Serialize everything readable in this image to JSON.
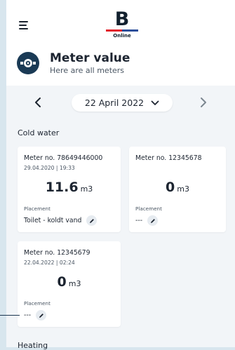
{
  "header": {
    "logo_letter": "B",
    "logo_sub": "Online",
    "title": "Meter value",
    "subtitle": "Here are all meters"
  },
  "date_nav": {
    "date": "22 April 2022"
  },
  "sections": {
    "cold_water": "Cold water",
    "heating": "Heating"
  },
  "meters": [
    {
      "number": "Meter no. 78649446000",
      "date": "29.04.2020 | 19:33",
      "value": "11.6",
      "unit": "m3",
      "placement_label": "Placement",
      "placement": "Toilet - koldt vand"
    },
    {
      "number": "Meter no. 12345678",
      "date": "",
      "value": "0",
      "unit": "m3",
      "placement_label": "Placement",
      "placement": "---"
    },
    {
      "number": "Meter no. 12345679",
      "date": "22.04.2022 | 02:24",
      "value": "0",
      "unit": "m3",
      "placement_label": "Placement",
      "placement": "---"
    }
  ],
  "colors": {
    "brand_red": "#e2202b",
    "brand_blue": "#2c4e9a",
    "badge": "#1a3a55",
    "background": "#f2f5f8"
  }
}
